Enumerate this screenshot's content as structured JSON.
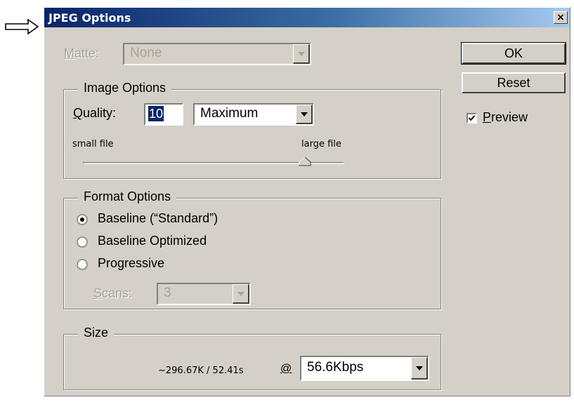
{
  "window": {
    "title": "JPEG Options",
    "close_label": "×"
  },
  "matte": {
    "label": "Matte:",
    "value": "None"
  },
  "image_options": {
    "legend": "Image Options",
    "quality_label": "Quality:",
    "quality_value": "10",
    "quality_preset": "Maximum",
    "slider_min_label": "small file",
    "slider_max_label": "large file",
    "slider_fraction": 0.85
  },
  "format_options": {
    "legend": "Format Options",
    "options": [
      {
        "label": "Baseline (“Standard”)",
        "selected": true
      },
      {
        "label": "Baseline Optimized",
        "selected": false
      },
      {
        "label": "Progressive",
        "selected": false
      }
    ],
    "scans_label": "Scans:",
    "scans_value": "3"
  },
  "size": {
    "legend": "Size",
    "estimate": "~296.67K / 52.41s",
    "at_symbol": "@",
    "speed": "56.6Kbps"
  },
  "buttons": {
    "ok": "OK",
    "reset": "Reset"
  },
  "preview": {
    "label": "Preview",
    "checked": true
  },
  "colors": {
    "dialog_bg": "#d4d0c8",
    "titlebar_start": "#0a246a",
    "titlebar_end": "#a6caf0"
  }
}
